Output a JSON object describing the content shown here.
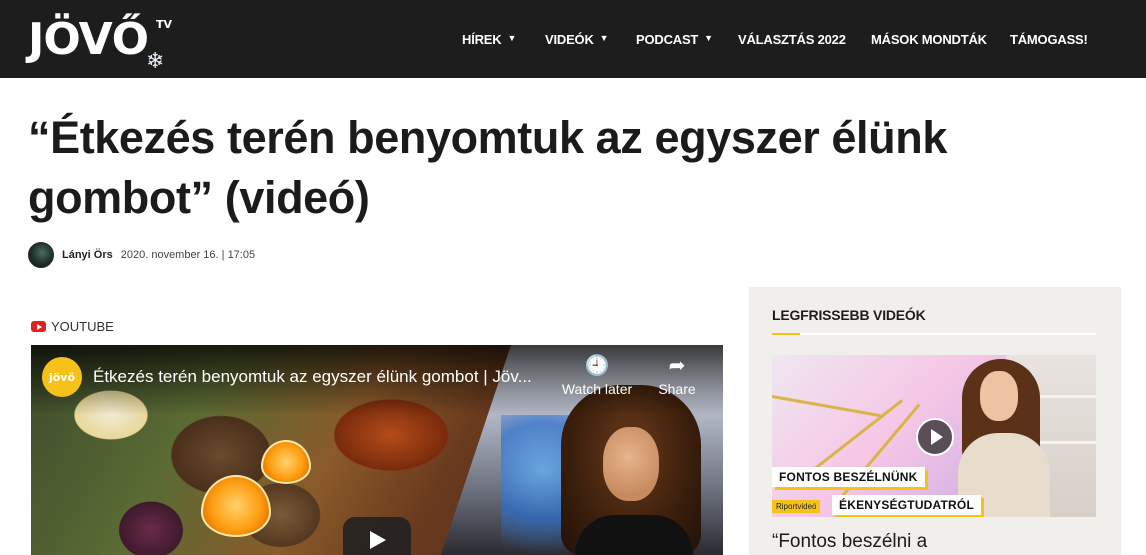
{
  "header": {
    "logo_text": "JÖVŐ",
    "logo_suffix": "TV",
    "nav": [
      {
        "label": "HÍREK",
        "dropdown": true
      },
      {
        "label": "VIDEÓK",
        "dropdown": true
      },
      {
        "label": "PODCAST",
        "dropdown": true
      },
      {
        "label": "VÁLASZTÁS 2022",
        "dropdown": false
      },
      {
        "label": "MÁSOK MONDTÁK",
        "dropdown": false
      },
      {
        "label": "TÁMOGASS!",
        "dropdown": false
      }
    ]
  },
  "article": {
    "title": "“Étkezés terén benyomtuk az egyszer élünk gombot” (videó)",
    "author": "Lányi Örs",
    "date": "2020. november 16. | 17:05",
    "source_label": "YOUTUBE"
  },
  "video": {
    "channel_badge": "jövő",
    "title": "Étkezés terén benyomtuk az egyszer élünk gombot | Jöv...",
    "watch_later": "Watch later",
    "share": "Share"
  },
  "sidebar": {
    "title": "LEGFRISSEBB VIDEÓK",
    "thumb_caption_1": "FONTOS BESZÉLNÜNK",
    "thumb_caption_2": "ÉKENYSÉGTUDATRÓL",
    "thumb_badge": "Riportvideó",
    "article_title": "“Fontos beszélni a"
  },
  "colors": {
    "header_bg": "#1d1d1d",
    "accent_yellow": "#f4c318",
    "youtube_red": "#e02020",
    "sidebar_bg": "#f1efeb"
  },
  "icons": {
    "chevron": "chevron-down-icon",
    "watch_later": "clock-icon",
    "share": "share-icon",
    "play": "play-icon",
    "source": "youtube-icon"
  }
}
